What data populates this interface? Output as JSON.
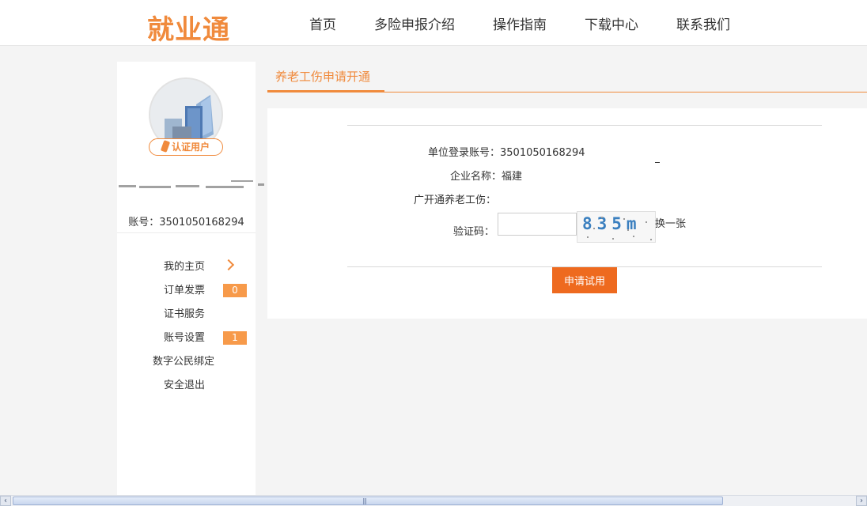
{
  "header": {
    "logo": "就业通",
    "nav": [
      "首页",
      "多险申报介绍",
      "操作指南",
      "下载中心",
      "联系我们"
    ]
  },
  "sidebar": {
    "badge": "认证用户",
    "account": "账号：3501050168294",
    "menu": [
      {
        "label": "我的主页"
      },
      {
        "label": "订单发票",
        "count": "0"
      },
      {
        "label": "证书服务"
      },
      {
        "label": "账号设置",
        "count": "1"
      },
      {
        "label": "数字公民绑定"
      },
      {
        "label": "安全退出"
      }
    ]
  },
  "main": {
    "tab": "养老工伤申请开通",
    "form": {
      "account_label": "单位登录账号：",
      "account_value": "3501050168294",
      "company_label": "企业名称：",
      "company_value": "福建",
      "open_label": "广开通养老工伤：",
      "captcha_label": "验证码：",
      "captcha_input": "",
      "captcha_text": "835m",
      "refresh": "换一张",
      "submit": "申请试用"
    }
  },
  "colors": {
    "accent": "#f08a3c",
    "button": "#ee6a1f",
    "captcha": "#3a7fbf"
  }
}
